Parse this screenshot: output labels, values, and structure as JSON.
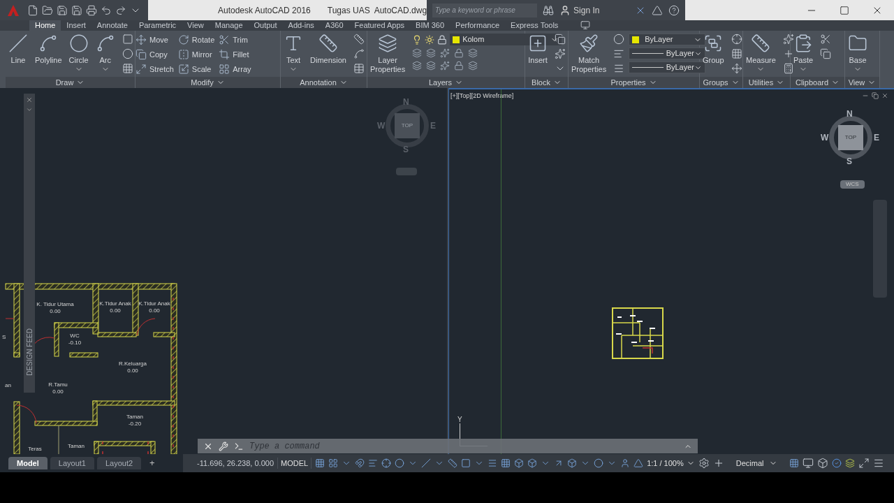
{
  "title_bar": {
    "app_name": "Autodesk AutoCAD 2016",
    "document": "Tugas UAS  AutoCAD.dwg",
    "search": {
      "placeholder": "Type a keyword or phrase"
    },
    "sign_in": "Sign In"
  },
  "ribbon_tabs": [
    {
      "label": "Home",
      "selected": true
    },
    {
      "label": "Insert",
      "selected": false
    },
    {
      "label": "Annotate",
      "selected": false
    },
    {
      "label": "Parametric",
      "selected": false
    },
    {
      "label": "View",
      "selected": false
    },
    {
      "label": "Manage",
      "selected": false
    },
    {
      "label": "Output",
      "selected": false
    },
    {
      "label": "Add-ins",
      "selected": false
    },
    {
      "label": "A360",
      "selected": false
    },
    {
      "label": "Featured Apps",
      "selected": false
    },
    {
      "label": "BIM 360",
      "selected": false
    },
    {
      "label": "Performance",
      "selected": false
    },
    {
      "label": "Express Tools",
      "selected": false
    }
  ],
  "panels": [
    {
      "title": "Draw",
      "columns": [
        {
          "kind": "large",
          "label": "Line",
          "caret": false
        },
        {
          "kind": "large",
          "label": "Polyline",
          "caret": false
        },
        {
          "kind": "large",
          "label": "Circle",
          "caret": true
        },
        {
          "kind": "large",
          "label": "Arc",
          "caret": true
        },
        {
          "kind": "icons"
        }
      ]
    },
    {
      "title": "Modify",
      "columns": [
        {
          "kind": "small",
          "items": [
            "Move",
            "Copy",
            "Stretch"
          ]
        },
        {
          "kind": "small",
          "items": [
            "Rotate",
            "Mirror",
            "Scale"
          ]
        },
        {
          "kind": "small",
          "items": [
            "Trim",
            "Fillet",
            "Array"
          ]
        },
        {
          "kind": "icons"
        }
      ]
    },
    {
      "title": "Annotation",
      "columns": [
        {
          "kind": "large",
          "label": "Text",
          "caret": true
        },
        {
          "kind": "large",
          "label": "Dimension",
          "caret": false
        },
        {
          "kind": "icons"
        }
      ]
    },
    {
      "title": "Layers",
      "columns": [
        {
          "kind": "large",
          "label": "Layer Properties",
          "caret": false
        },
        {
          "kind": "layer",
          "value": "Kolom"
        }
      ]
    },
    {
      "title": "Block",
      "columns": [
        {
          "kind": "large",
          "label": "Insert",
          "caret": false
        },
        {
          "kind": "icons"
        }
      ]
    },
    {
      "title": "Properties",
      "columns": [
        {
          "kind": "large",
          "label": "Match Properties",
          "caret": false
        },
        {
          "kind": "icons"
        },
        {
          "kind": "dropdowns",
          "items": [
            "ByLayer",
            "ByLayer",
            "ByLayer"
          ]
        }
      ]
    },
    {
      "title": "Groups",
      "columns": [
        {
          "kind": "large",
          "label": "Group",
          "caret": false
        },
        {
          "kind": "icons"
        }
      ]
    },
    {
      "title": "Utilities",
      "columns": [
        {
          "kind": "large",
          "label": "Measure",
          "caret": true
        },
        {
          "kind": "icons"
        }
      ]
    },
    {
      "title": "Clipboard",
      "columns": [
        {
          "kind": "large",
          "label": "Paste",
          "caret": true
        },
        {
          "kind": "icons"
        }
      ]
    },
    {
      "title": "View",
      "columns": [
        {
          "kind": "large",
          "label": "Base",
          "caret": true
        }
      ]
    }
  ],
  "left_viewport": {
    "compass": {
      "n": "N",
      "s": "S",
      "e": "E",
      "w": "W",
      "face": "TOP"
    },
    "design_feed": "DESIGN FEED",
    "rooms": [
      {
        "name": "K. Tidur Utama",
        "level": "0.00"
      },
      {
        "name": "K.Tidur Anak",
        "level": "0.00"
      },
      {
        "name": "K.Tidur Anak",
        "level": "0.00"
      },
      {
        "name": "WC",
        "level": "-0.10"
      },
      {
        "name": "R.Keluarga",
        "level": "0.00"
      },
      {
        "name": "R.Tamu",
        "level": "0.00"
      },
      {
        "name": "Taman",
        "level": "-0.20"
      },
      {
        "name": "Teras"
      },
      {
        "name": "Taman"
      },
      {
        "name": "S"
      },
      {
        "name": "an"
      }
    ]
  },
  "right_viewport": {
    "label": "[+][Top][2D Wireframe]",
    "compass": {
      "n": "N",
      "s": "S",
      "e": "E",
      "w": "W",
      "face": "TOP"
    },
    "ucs": "WCS",
    "axis": "Y"
  },
  "command_line": {
    "placeholder": "Type a command"
  },
  "layout_tabs": [
    {
      "label": "Model",
      "selected": true
    },
    {
      "label": "Layout1",
      "selected": false
    },
    {
      "label": "Layout2",
      "selected": false
    }
  ],
  "add_tab": "+",
  "status_bar": {
    "coordinates": "-11.696, 26.238, 0.000",
    "space": "MODEL",
    "scale": "1:1 / 100%",
    "units": "Decimal"
  }
}
